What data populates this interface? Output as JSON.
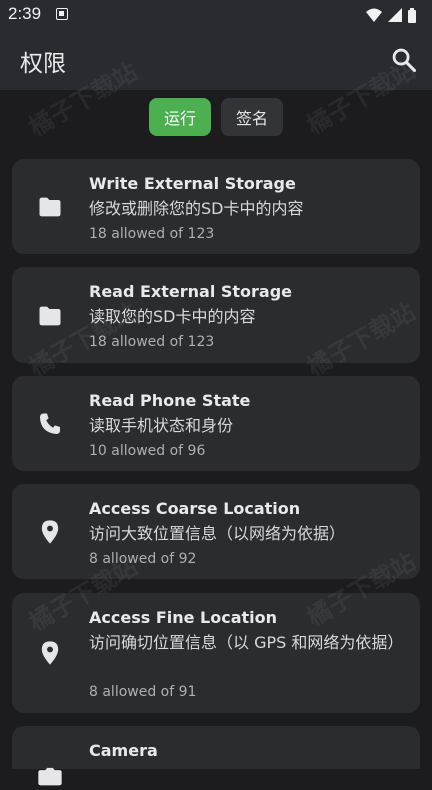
{
  "status_bar": {
    "time": "2:39",
    "icons": [
      "notification-icon",
      "wifi-icon",
      "signal-icon",
      "battery-icon"
    ]
  },
  "header": {
    "title": "权限",
    "search_icon": "search-icon"
  },
  "tabs": [
    {
      "label": "运行",
      "selected": true
    },
    {
      "label": "签名",
      "selected": false
    }
  ],
  "permissions": [
    {
      "title": "Write External Storage",
      "description": "修改或删除您的SD卡中的内容",
      "count": "18 allowed of 123",
      "icon": "folder-icon"
    },
    {
      "title": "Read External Storage",
      "description": "读取您的SD卡中的内容",
      "count": "18 allowed of 123",
      "icon": "folder-icon"
    },
    {
      "title": "Read Phone State",
      "description": "读取手机状态和身份",
      "count": "10 allowed of 96",
      "icon": "phone-icon"
    },
    {
      "title": "Access Coarse Location",
      "description": "访问大致位置信息（以网络为依据）",
      "count": "8 allowed of 92",
      "icon": "location-pin-icon"
    },
    {
      "title": "Access Fine Location",
      "description": "访问确切位置信息（以 GPS 和网络为依据）",
      "count": "8 allowed of 91",
      "icon": "location-pin-icon"
    },
    {
      "title": "Camera",
      "description": "",
      "count": "",
      "icon": "camera-icon"
    }
  ],
  "watermark": "橘子下载站",
  "colors": {
    "background": "#1c1c1e",
    "card": "#2b2c30",
    "accent_green": "#4caf50"
  }
}
